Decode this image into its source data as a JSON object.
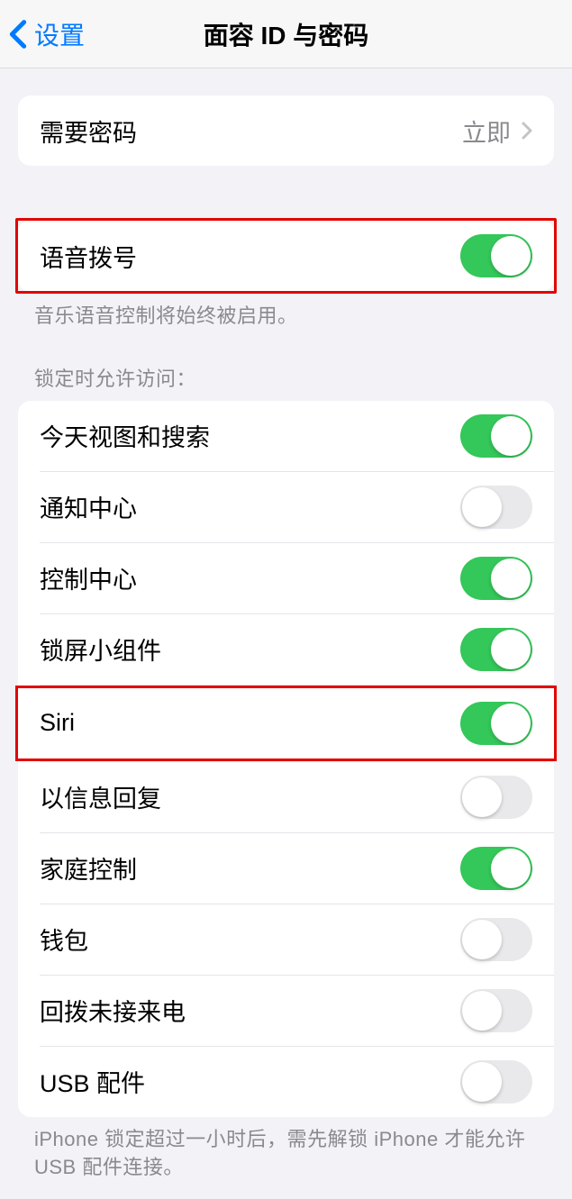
{
  "nav": {
    "back_label": "设置",
    "title": "面容 ID 与密码"
  },
  "passcode": {
    "label": "需要密码",
    "value": "立即"
  },
  "voice_dial": {
    "label": "语音拨号",
    "on": true,
    "footer": "音乐语音控制将始终被启用。"
  },
  "lock_access": {
    "header": "锁定时允许访问：",
    "items": [
      {
        "label": "今天视图和搜索",
        "on": true
      },
      {
        "label": "通知中心",
        "on": false
      },
      {
        "label": "控制中心",
        "on": true
      },
      {
        "label": "锁屏小组件",
        "on": true
      },
      {
        "label": "Siri",
        "on": true
      },
      {
        "label": "以信息回复",
        "on": false
      },
      {
        "label": "家庭控制",
        "on": true
      },
      {
        "label": "钱包",
        "on": false
      },
      {
        "label": "回拨未接来电",
        "on": false
      },
      {
        "label": "USB 配件",
        "on": false
      }
    ],
    "footer": "iPhone 锁定超过一小时后，需先解锁 iPhone 才能允许 USB 配件连接。"
  }
}
